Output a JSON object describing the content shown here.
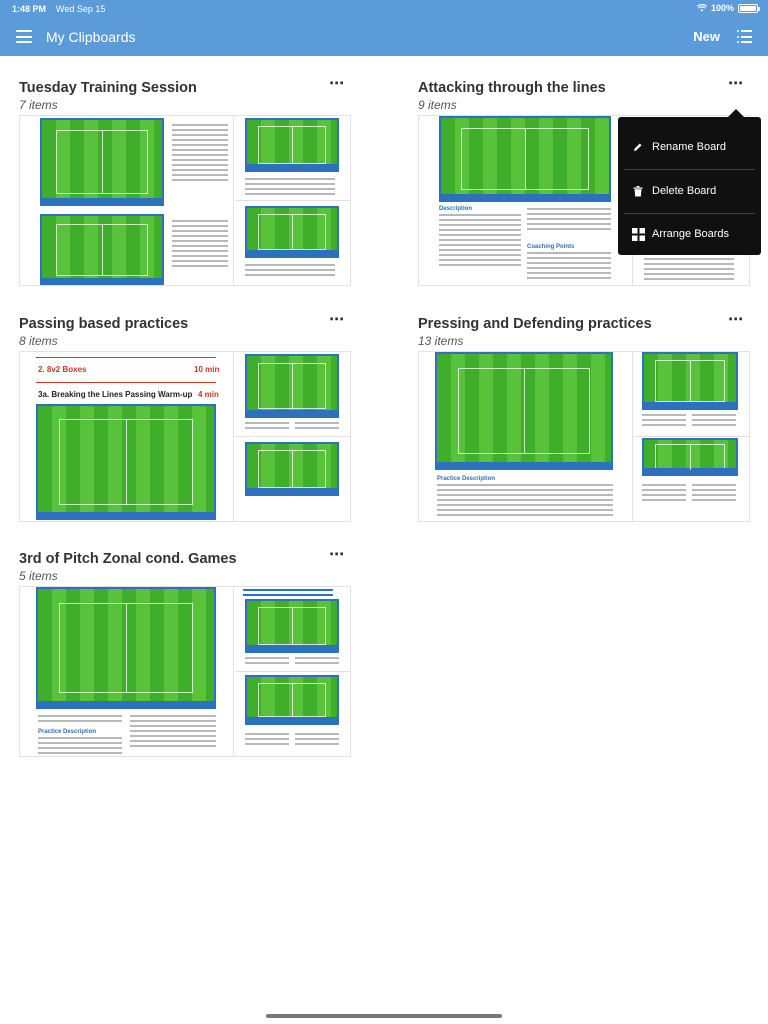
{
  "status_bar": {
    "time": "1:48 PM",
    "date": "Wed Sep 15",
    "battery": "100%"
  },
  "nav": {
    "title": "My Clipboards",
    "new_label": "New"
  },
  "boards": [
    {
      "title": "Tuesday Training Session",
      "count": "7 items",
      "more": "⋯"
    },
    {
      "title": "Attacking through the lines",
      "count": "9 items",
      "more": "⋯"
    },
    {
      "title": "Passing based practices",
      "count": "8 items",
      "more": "⋯"
    },
    {
      "title": "Pressing and Defending practices",
      "count": "13 items",
      "more": "⋯"
    },
    {
      "title": "3rd of Pitch Zonal cond. Games",
      "count": "5 items",
      "more": "⋯"
    }
  ],
  "thumb_text": {
    "passing_heading_1": "2. 8v2 Boxes",
    "passing_time_1": "10 min",
    "passing_heading_2": "3a. Breaking the Lines Passing Warm-up",
    "passing_time_2": "4 min",
    "attacking_desc": "Description",
    "attacking_coaching": "Coaching Points",
    "pressing_desc": "Practice Description",
    "zonal_desc": "Practice Description"
  },
  "context_menu": {
    "items": [
      {
        "label": "Rename Board",
        "icon": "pencil-icon"
      },
      {
        "label": "Delete Board",
        "icon": "trash-icon"
      },
      {
        "label": "Arrange Boards",
        "icon": "grid-icon"
      }
    ]
  }
}
